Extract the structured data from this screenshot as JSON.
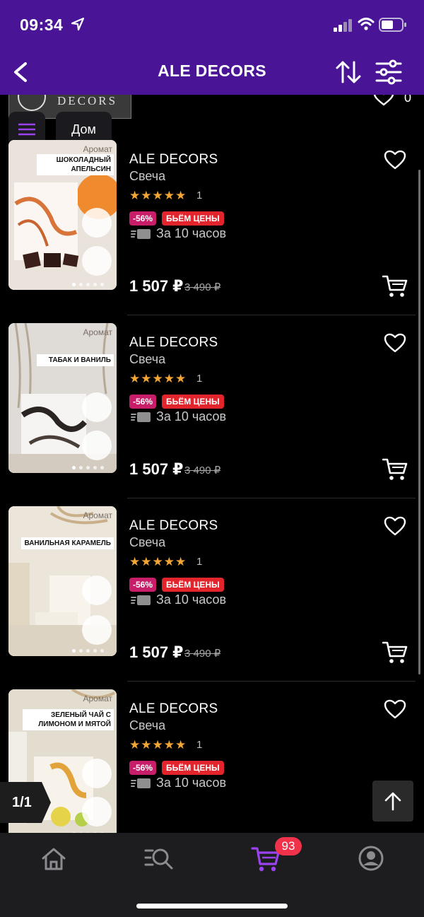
{
  "status_bar": {
    "time": "09:34"
  },
  "header": {
    "title": "ALE DECORS"
  },
  "store_banner": {
    "logo_text": "DECORS",
    "favorites_count": "0"
  },
  "category_chip": {
    "label": "Дом"
  },
  "products": [
    {
      "brand": "ALE DECORS",
      "type": "Свеча",
      "stars": "★★★★★",
      "rating_count": "1",
      "discount": "-56%",
      "promo": "БЬЁМ ЦЕНЫ",
      "delivery": "За 10 часов",
      "price": "1 507 ₽",
      "old_price": "3 490 ₽",
      "image_aroma": "Аромат",
      "image_label": "ШОКОЛАДНЫЙ АПЕЛЬСИН"
    },
    {
      "brand": "ALE DECORS",
      "type": "Свеча",
      "stars": "★★★★★",
      "rating_count": "1",
      "discount": "-56%",
      "promo": "БЬЁМ ЦЕНЫ",
      "delivery": "За 10 часов",
      "price": "1 507 ₽",
      "old_price": "3 490 ₽",
      "image_aroma": "Аромат",
      "image_label": "ТАБАК И ВАНИЛЬ"
    },
    {
      "brand": "ALE DECORS",
      "type": "Свеча",
      "stars": "★★★★★",
      "rating_count": "1",
      "discount": "-56%",
      "promo": "БЬЁМ ЦЕНЫ",
      "delivery": "За 10 часов",
      "price": "1 507 ₽",
      "old_price": "3 490 ₽",
      "image_aroma": "Аромат",
      "image_label": "ВАНИЛЬНАЯ КАРАМЕЛЬ"
    },
    {
      "brand": "ALE DECORS",
      "type": "Свеча",
      "stars": "★★★★★",
      "rating_count": "1",
      "discount": "-56%",
      "promo": "БЬЁМ ЦЕНЫ",
      "delivery": "За 10 часов",
      "price": "",
      "old_price": "",
      "image_aroma": "Аромат",
      "image_label": "ЗЕЛЕНЫЙ ЧАЙ С ЛИМОНОМ И МЯТОЙ"
    }
  ],
  "pagination": {
    "label": "1/1"
  },
  "tab_bar": {
    "items": [
      {
        "icon": "home-icon"
      },
      {
        "icon": "catalog-search-icon"
      },
      {
        "icon": "cart-icon",
        "active": true
      },
      {
        "icon": "profile-icon"
      }
    ],
    "cart_badge": "93"
  },
  "colors": {
    "header_bg": "#4a1497",
    "accent": "#9b42f0",
    "star": "#f3a535",
    "discount_bg": "#c81e6a",
    "promo_bg": "#e2252d",
    "badge_bg": "#f0334a"
  }
}
